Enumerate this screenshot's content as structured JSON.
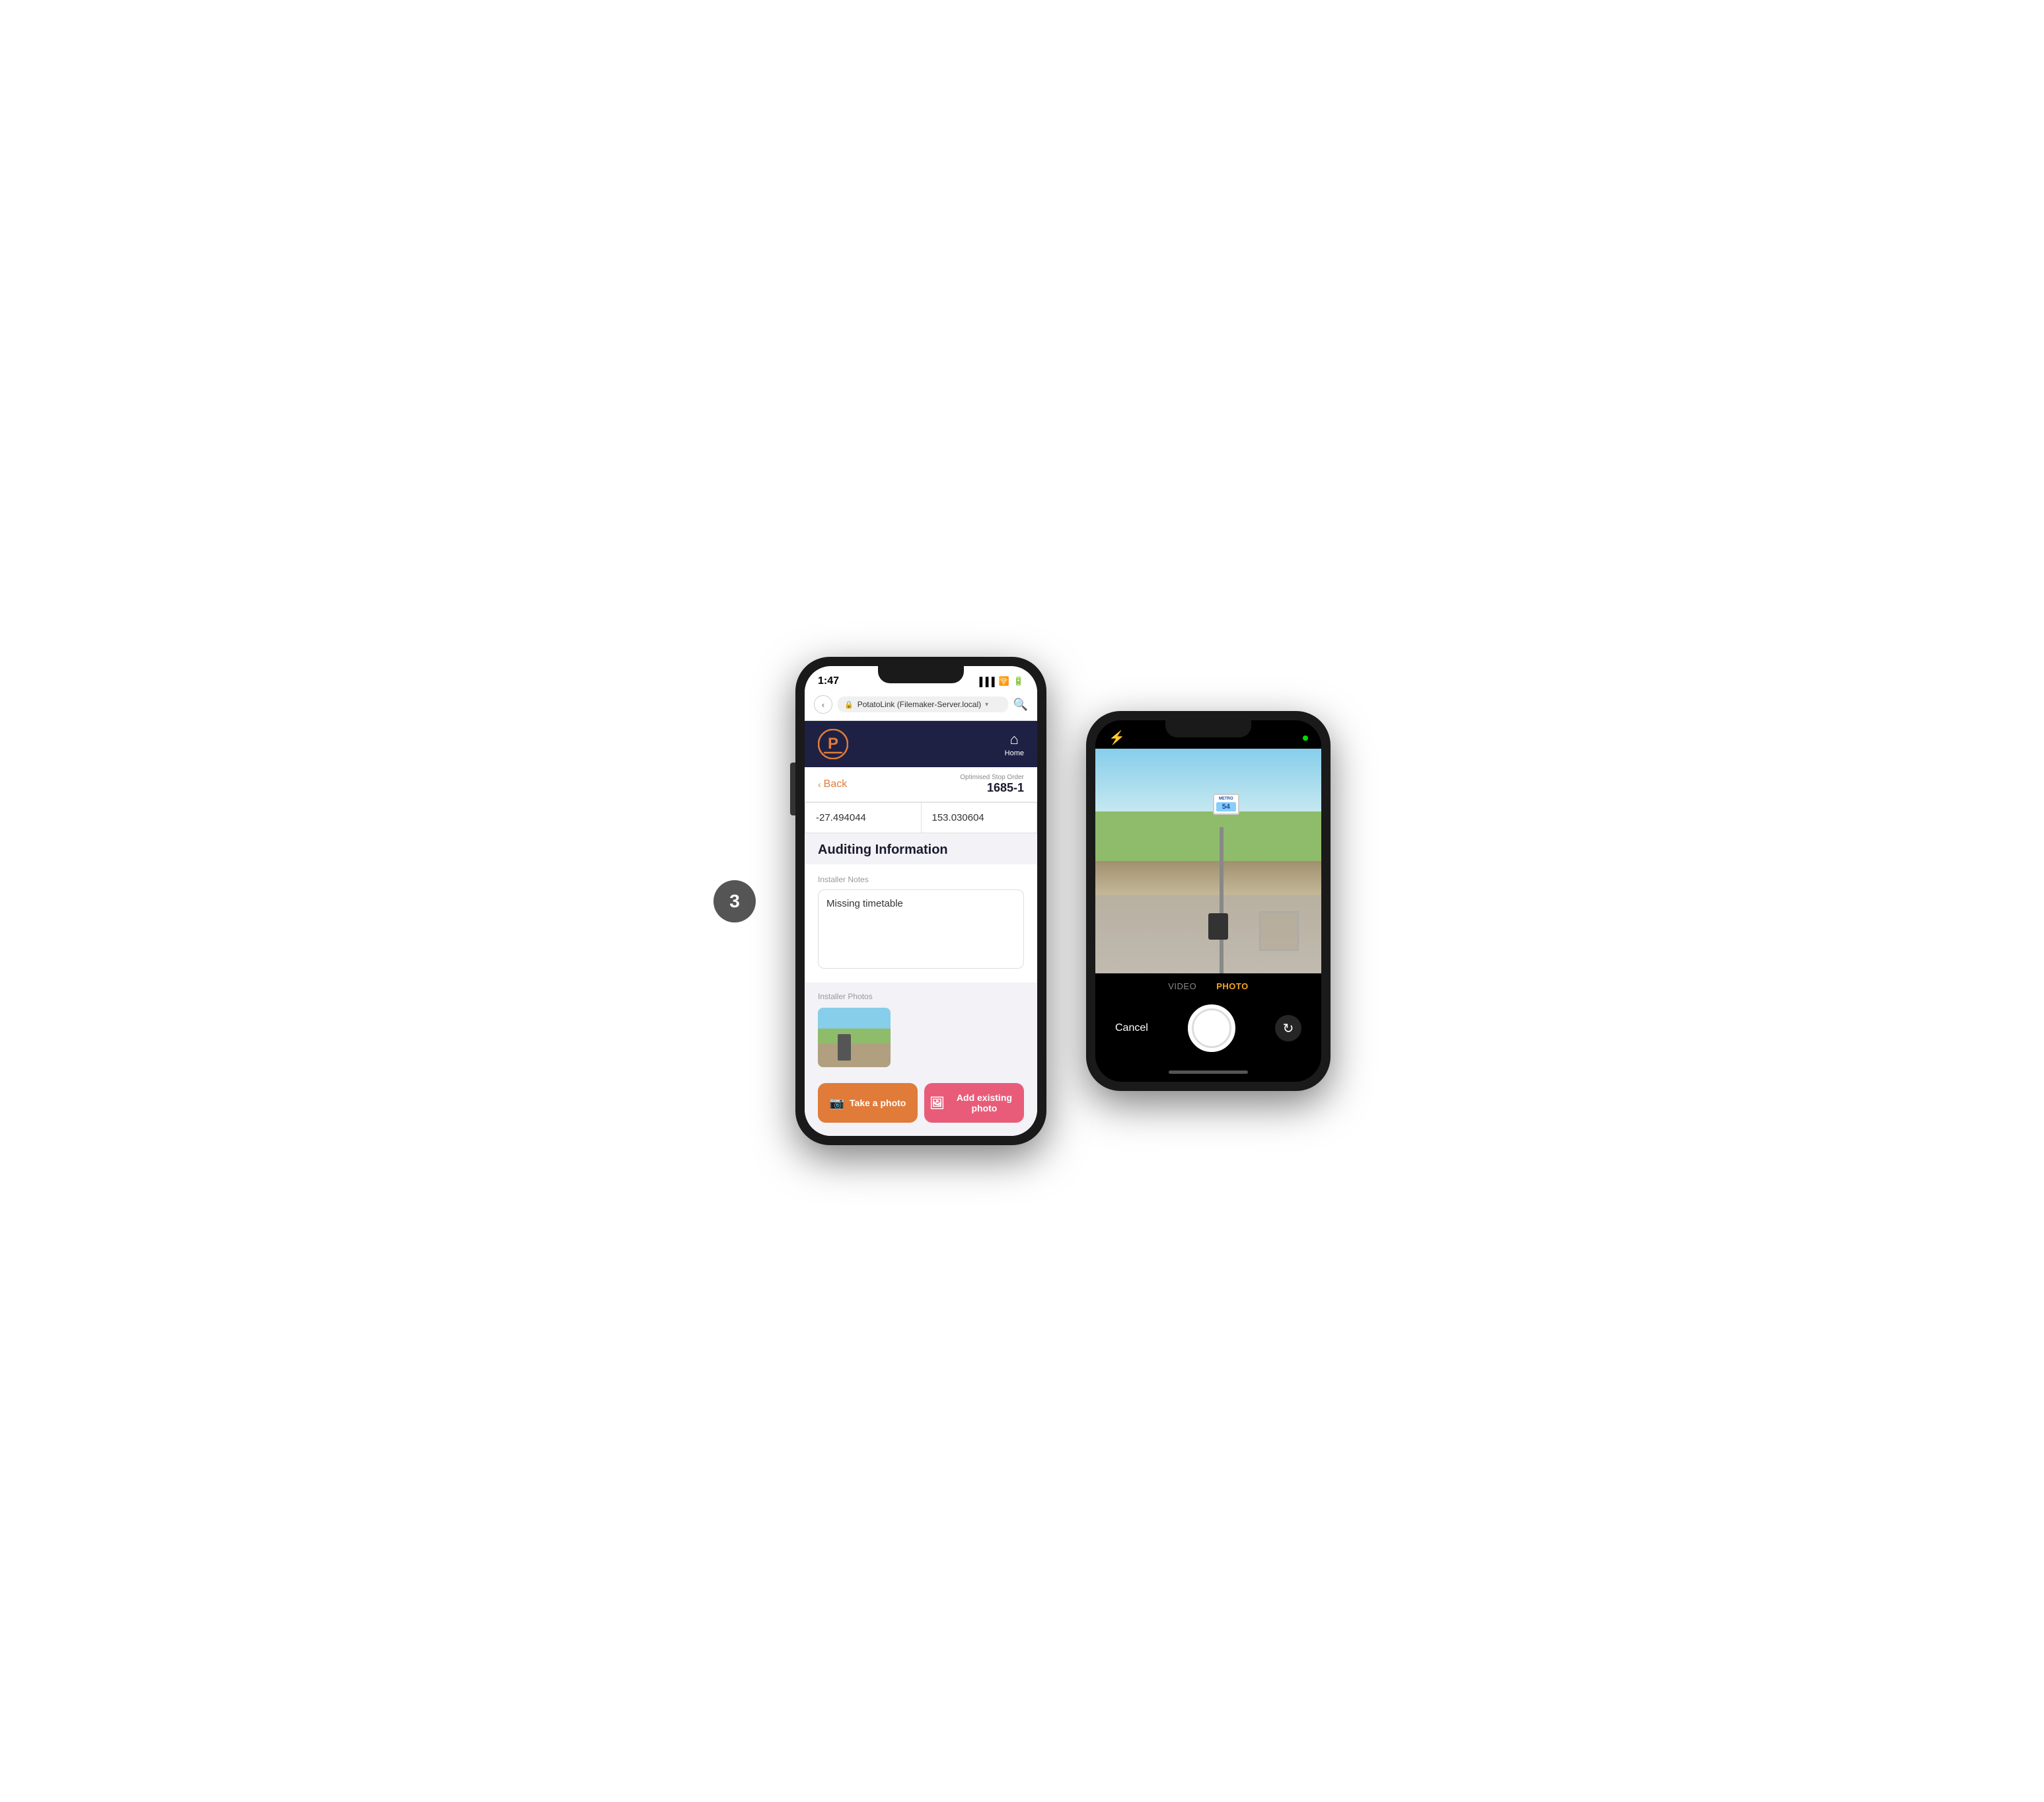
{
  "scene": {
    "step_badge": "3"
  },
  "left_phone": {
    "status_bar": {
      "time": "1:47",
      "signal": "▐▐▐",
      "wifi": "◈",
      "battery": "▓"
    },
    "url_bar": {
      "back_label": "‹",
      "url": "PotatoLink (Filemaker-Server.local)",
      "url_chevron": "▾",
      "search_icon": "⌕"
    },
    "app_header": {
      "home_label": "Home"
    },
    "nav": {
      "back_label": "Back",
      "order_label": "Optimised Stop Order",
      "order_value": "1685-1"
    },
    "coordinates": {
      "lat": "-27.494044",
      "lng": "153.030604"
    },
    "auditing_section": {
      "title": "Auditing Information",
      "installer_notes_label": "Installer Notes",
      "notes_value": "Missing timetable",
      "installer_photos_label": "Installer Photos"
    },
    "buttons": {
      "take_photo": "Take a photo",
      "add_existing": "Add existing photo"
    }
  },
  "right_phone": {
    "camera": {
      "flash_icon": "⚡",
      "modes": [
        "VIDEO",
        "PHOTO"
      ],
      "active_mode": "PHOTO",
      "cancel_label": "Cancel",
      "metro_sign_label": "METRO",
      "bus_number": "54"
    }
  }
}
